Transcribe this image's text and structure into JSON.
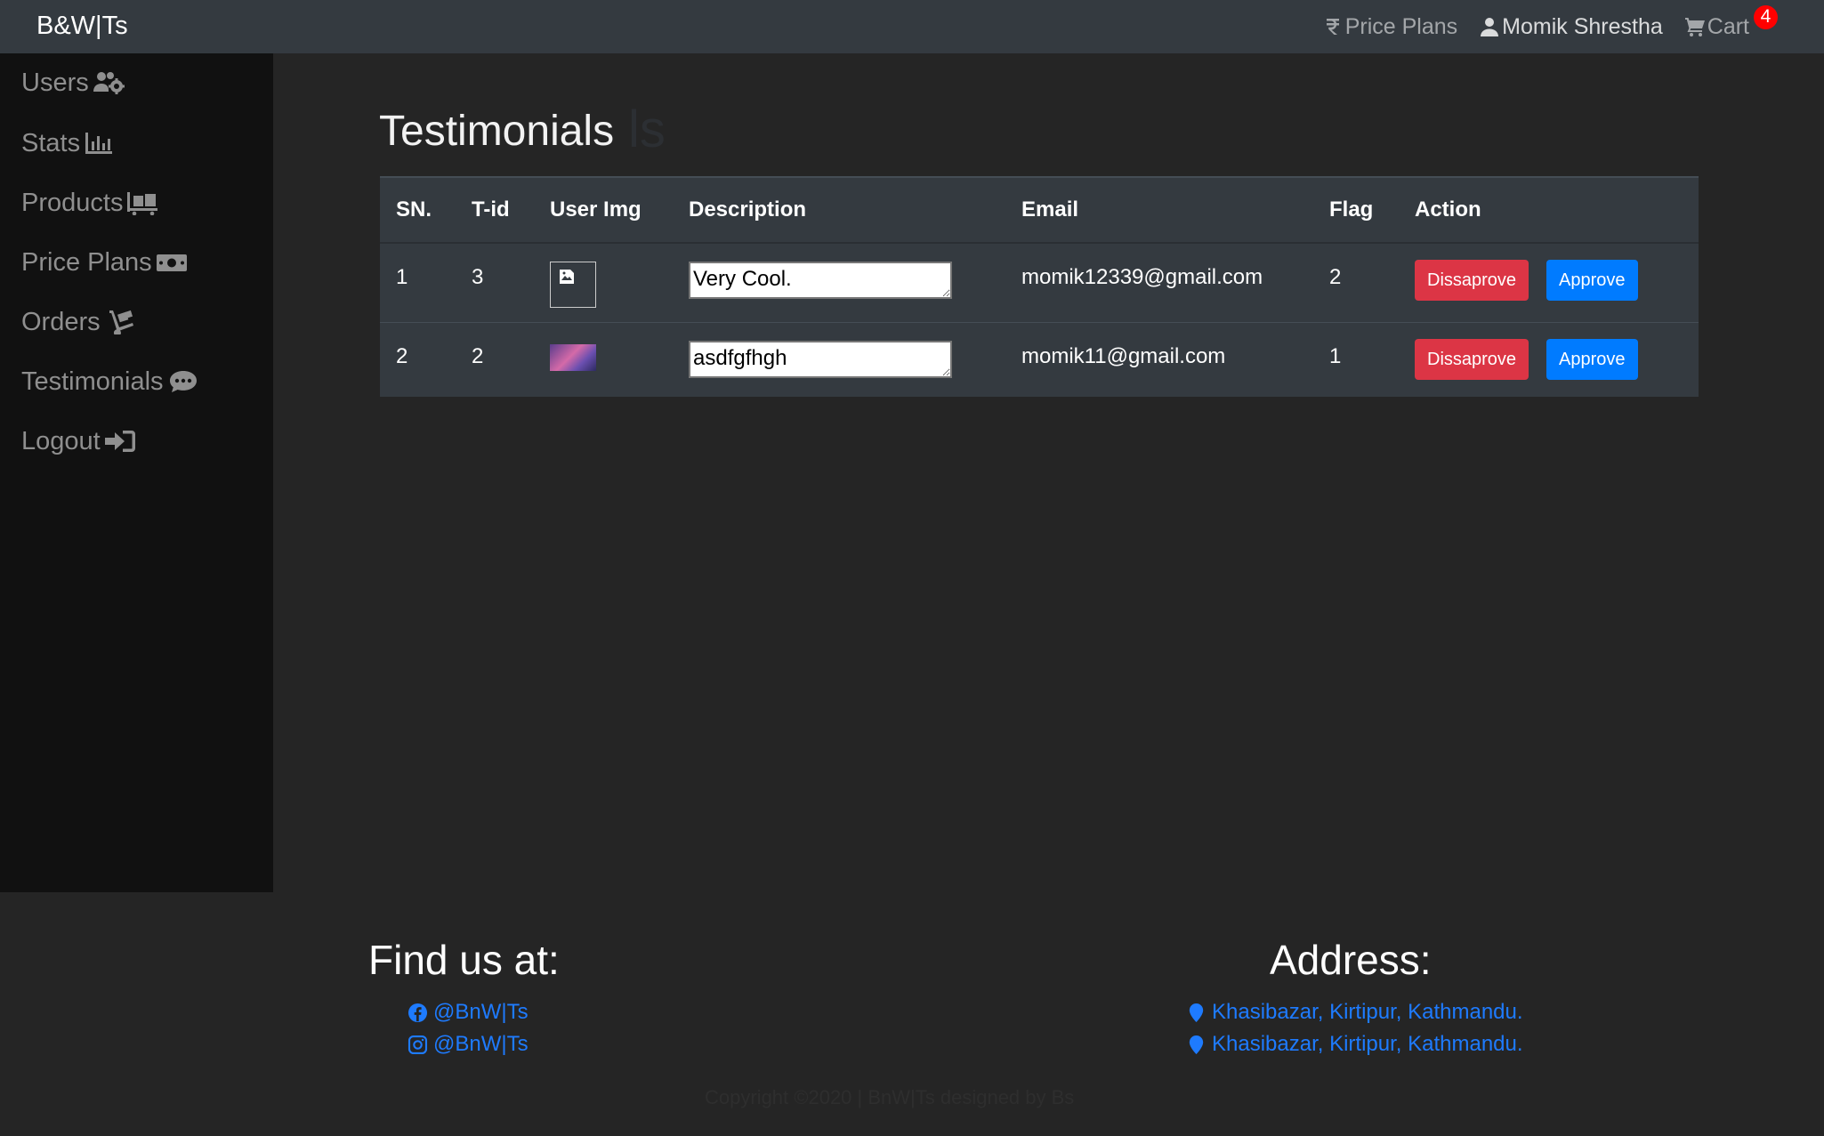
{
  "navbar": {
    "brand": "B&W|Ts",
    "price_plans": "Price Plans",
    "user_name": "Momik Shrestha",
    "cart_label": "Cart",
    "cart_count": "4"
  },
  "sidebar": {
    "items": [
      {
        "label": "Users",
        "icon": "users-cog-icon"
      },
      {
        "label": "Stats",
        "icon": "chart-bar-icon"
      },
      {
        "label": "Products",
        "icon": "dolly-flatbed-icon"
      },
      {
        "label": "Price Plans",
        "icon": "money-bill-icon"
      },
      {
        "label": "Orders",
        "icon": "dolly-icon"
      },
      {
        "label": "Testimonials",
        "icon": "comment-dots-icon"
      },
      {
        "label": "Logout",
        "icon": "sign-in-icon"
      }
    ]
  },
  "main": {
    "title": "Testimonials",
    "ghost_text": "ls",
    "table": {
      "headers": [
        "SN.",
        "T-id",
        "User Img",
        "Description",
        "Email",
        "Flag",
        "Action"
      ],
      "rows": [
        {
          "sn": "1",
          "tid": "3",
          "description": "Very Cool.",
          "email": "momik12339@gmail.com",
          "flag": "2"
        },
        {
          "sn": "2",
          "tid": "2",
          "description": "asdfgfhgh",
          "email": "momik11@gmail.com",
          "flag": "1"
        }
      ],
      "disapprove_label": "Dissaprove",
      "approve_label": "Approve"
    }
  },
  "footer": {
    "find_title": "Find us at:",
    "facebook": "@BnW|Ts",
    "instagram": "@BnW|Ts",
    "address_title": "Address:",
    "address1": "Khasibazar, Kirtipur, Kathmandu.",
    "address2": "Khasibazar, Kirtipur, Kathmandu.",
    "copyright": "Copyright ©2020 | BnW|Ts designed by Bs"
  },
  "colors": {
    "navbar_bg": "#343a40",
    "sidebar_bg": "#111111",
    "page_bg": "#252525",
    "danger": "#dc3545",
    "primary": "#007bff",
    "link": "#1e7bff",
    "badge": "#ff0000"
  }
}
